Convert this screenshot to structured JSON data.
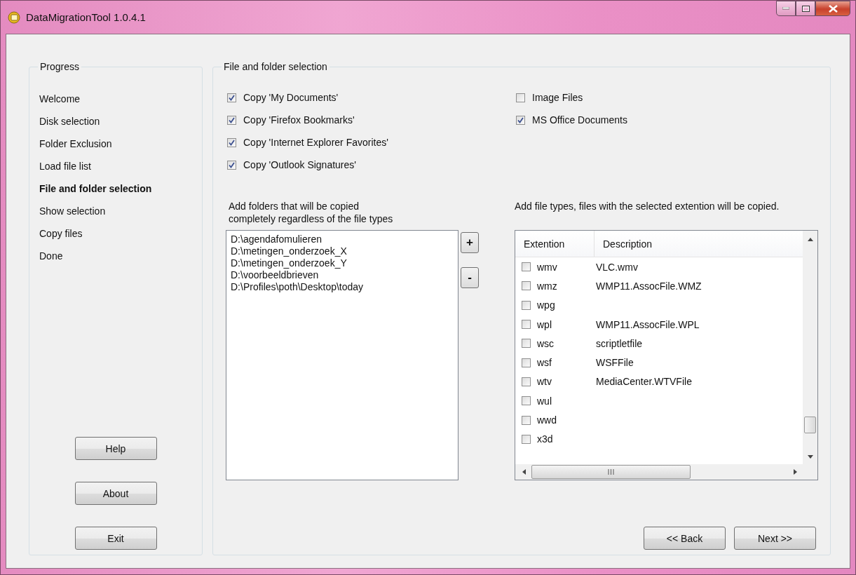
{
  "window": {
    "title": "DataMigrationTool 1.0.4.1"
  },
  "progress": {
    "title": "Progress",
    "steps": [
      {
        "label": "Welcome",
        "selected": false
      },
      {
        "label": "Disk selection",
        "selected": false
      },
      {
        "label": "Folder Exclusion",
        "selected": false
      },
      {
        "label": "Load file list",
        "selected": false
      },
      {
        "label": "File and folder selection",
        "selected": true
      },
      {
        "label": "Show selection",
        "selected": false
      },
      {
        "label": "Copy files",
        "selected": false
      },
      {
        "label": "Done",
        "selected": false
      }
    ],
    "buttons": [
      "Help",
      "About",
      "Exit"
    ]
  },
  "selection": {
    "title": "File and folder selection",
    "options_left": [
      {
        "label": "Copy 'My Documents'",
        "checked": true
      },
      {
        "label": "Copy 'Firefox Bookmarks'",
        "checked": true
      },
      {
        "label": "Copy 'Internet Explorer Favorites'",
        "checked": true
      },
      {
        "label": "Copy 'Outlook Signatures'",
        "checked": true
      }
    ],
    "options_right": [
      {
        "label": "Image Files",
        "checked": false
      },
      {
        "label": "MS Office Documents",
        "checked": true
      }
    ],
    "folders": {
      "label": "Add folders that will be copied completely regardless of the file types",
      "items": [
        "D:\\agendafomulieren",
        "D:\\metingen_onderzoek_X",
        "D:\\metingen_onderzoek_Y",
        "D:\\voorbeeldbrieven",
        "D:\\Profiles\\poth\\Desktop\\today"
      ],
      "add": "+",
      "remove": "-"
    },
    "file_types": {
      "label": "Add file types, files with the selected extention will be copied.",
      "columns": [
        "Extention",
        "Description"
      ],
      "rows": [
        {
          "ext": "wmv",
          "desc": "VLC.wmv",
          "checked": false
        },
        {
          "ext": "wmz",
          "desc": "WMP11.AssocFile.WMZ",
          "checked": false
        },
        {
          "ext": "wpg",
          "desc": "",
          "checked": false
        },
        {
          "ext": "wpl",
          "desc": "WMP11.AssocFile.WPL",
          "checked": false
        },
        {
          "ext": "wsc",
          "desc": "scriptletfile",
          "checked": false
        },
        {
          "ext": "wsf",
          "desc": "WSFFile",
          "checked": false
        },
        {
          "ext": "wtv",
          "desc": "MediaCenter.WTVFile",
          "checked": false
        },
        {
          "ext": "wul",
          "desc": "",
          "checked": false
        },
        {
          "ext": "wwd",
          "desc": "",
          "checked": false
        },
        {
          "ext": "x3d",
          "desc": "",
          "checked": false
        }
      ]
    },
    "nav": [
      "<< Back",
      "Next >>"
    ]
  }
}
